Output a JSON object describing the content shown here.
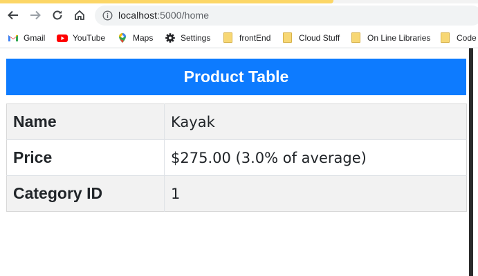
{
  "browser": {
    "url_host": "localhost",
    "url_path": ":5000/home",
    "bookmarks": [
      {
        "label": "Gmail",
        "icon": "gmail-icon"
      },
      {
        "label": "YouTube",
        "icon": "youtube-icon"
      },
      {
        "label": "Maps",
        "icon": "maps-icon"
      },
      {
        "label": "Settings",
        "icon": "gear-icon"
      },
      {
        "label": "frontEnd",
        "icon": "folder-icon"
      },
      {
        "label": "Cloud Stuff",
        "icon": "folder-icon"
      },
      {
        "label": "On Line Libraries",
        "icon": "folder-icon"
      },
      {
        "label": "Code V",
        "icon": "folder-icon"
      }
    ]
  },
  "page": {
    "title": "Product Table",
    "rows": [
      {
        "key": "Name",
        "value": "Kayak"
      },
      {
        "key": "Price",
        "value": "$275.00 (3.0% of average)"
      },
      {
        "key": "Category ID",
        "value": "1"
      }
    ]
  },
  "colors": {
    "banner": "#0d7bff",
    "stripe": "#f2f2f2"
  }
}
